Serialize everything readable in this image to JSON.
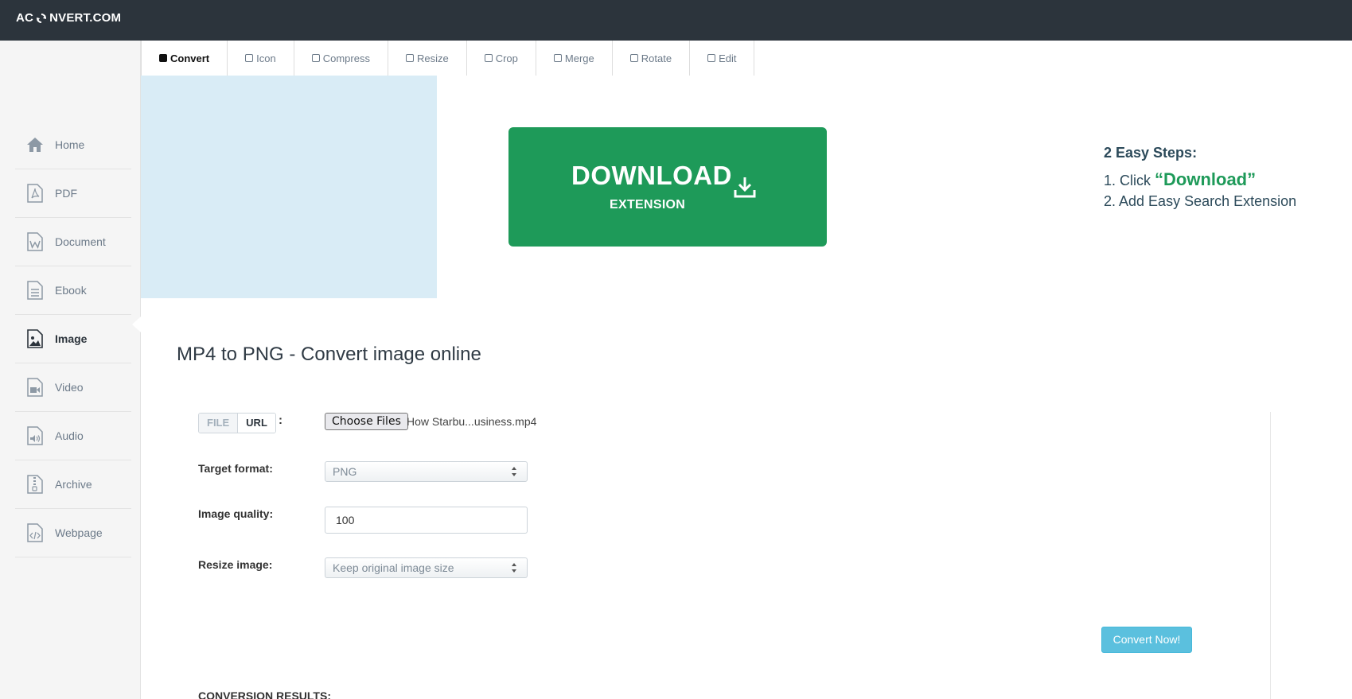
{
  "header": {
    "logo_left": "AC",
    "logo_right": "NVERT.COM",
    "logo_icon": "refresh-arrows-icon"
  },
  "sidebar": {
    "items": [
      {
        "label": "Home",
        "icon": "home-icon"
      },
      {
        "label": "PDF",
        "icon": "pdf-file-icon"
      },
      {
        "label": "Document",
        "icon": "word-document-icon"
      },
      {
        "label": "Ebook",
        "icon": "ebook-file-icon"
      },
      {
        "label": "Image",
        "icon": "image-file-icon",
        "active": true
      },
      {
        "label": "Video",
        "icon": "video-file-icon"
      },
      {
        "label": "Audio",
        "icon": "audio-file-icon"
      },
      {
        "label": "Archive",
        "icon": "archive-file-icon"
      },
      {
        "label": "Webpage",
        "icon": "code-file-icon"
      }
    ]
  },
  "tabs": [
    {
      "label": "Convert",
      "active": true
    },
    {
      "label": "Icon"
    },
    {
      "label": "Compress"
    },
    {
      "label": "Resize"
    },
    {
      "label": "Crop"
    },
    {
      "label": "Merge"
    },
    {
      "label": "Rotate"
    },
    {
      "label": "Edit"
    }
  ],
  "banner": {
    "download_main": "DOWNLOAD",
    "download_sub": "EXTENSION",
    "steps_title": "2 Easy Steps:",
    "step1_prefix": "1. Click ",
    "step1_link": "“Download”",
    "step2": "2. Add Easy Search Extension",
    "button_color": "#1e9a59"
  },
  "main": {
    "title": "MP4 to PNG - Convert image online",
    "source_toggle": {
      "file": "FILE",
      "url": "URL",
      "colon": ":"
    },
    "file_button": "Choose Files",
    "file_name": "How Starbu...usiness.mp4",
    "target_format": {
      "label": "Target format:",
      "value": "PNG"
    },
    "image_quality": {
      "label": "Image quality:",
      "value": "100"
    },
    "resize_image": {
      "label": "Resize image:",
      "value": "Keep original image size"
    },
    "convert_button": "Convert Now!",
    "convert_color": "#5bc0de",
    "results_label": "CONVERSION RESULTS:"
  }
}
